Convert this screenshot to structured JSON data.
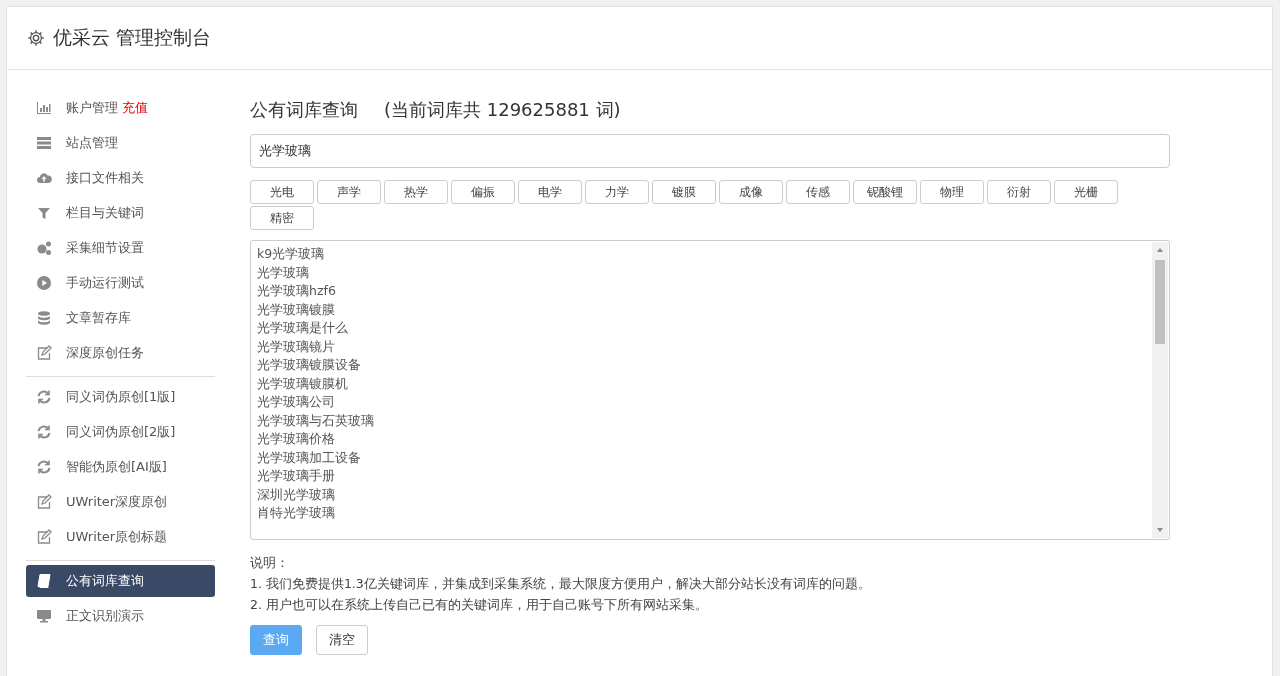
{
  "header": {
    "title": "优采云 管理控制台"
  },
  "sidebar": {
    "groups": [
      {
        "items": [
          {
            "label": "账户管理",
            "badge": "充值",
            "selected": false
          },
          {
            "label": "站点管理",
            "selected": false
          },
          {
            "label": "接口文件相关",
            "selected": false
          },
          {
            "label": "栏目与关键词",
            "selected": false
          },
          {
            "label": "采集细节设置",
            "selected": false
          },
          {
            "label": "手动运行测试",
            "selected": false
          },
          {
            "label": "文章暂存库",
            "selected": false
          },
          {
            "label": "深度原创任务",
            "selected": false
          }
        ]
      },
      {
        "items": [
          {
            "label": "同义词伪原创[1版]",
            "selected": false
          },
          {
            "label": "同义词伪原创[2版]",
            "selected": false
          },
          {
            "label": "智能伪原创[AI版]",
            "selected": false
          },
          {
            "label": "UWriter深度原创",
            "selected": false
          },
          {
            "label": "UWriter原创标题",
            "selected": false
          }
        ]
      },
      {
        "items": [
          {
            "label": "公有词库查询",
            "selected": true
          },
          {
            "label": "正文识别演示",
            "selected": false
          }
        ]
      }
    ]
  },
  "main": {
    "title": "公有词库查询",
    "count_text": "(当前词库共 129625881 词)",
    "search": {
      "value": "光学玻璃"
    },
    "tags": [
      "光电",
      "声学",
      "热学",
      "偏振",
      "电学",
      "力学",
      "镀膜",
      "成像",
      "传感",
      "铌酸锂",
      "物理",
      "衍射",
      "光栅",
      "精密"
    ],
    "results": [
      "k9光学玻璃",
      "光学玻璃",
      "光学玻璃hzf6",
      "光学玻璃镀膜",
      "光学玻璃是什么",
      "光学玻璃镜片",
      "光学玻璃镀膜设备",
      "光学玻璃镀膜机",
      "光学玻璃公司",
      "光学玻璃与石英玻璃",
      "光学玻璃价格",
      "光学玻璃加工设备",
      "光学玻璃手册",
      "深圳光学玻璃",
      "肖特光学玻璃"
    ],
    "notes_title": "说明：",
    "notes": [
      "1. 我们免费提供1.3亿关键词库，并集成到采集系统，最大限度方便用户，解决大部分站长没有词库的问题。",
      "2. 用户也可以在系统上传自己已有的关键词库，用于自己账号下所有网站采集。"
    ],
    "buttons": [
      {
        "label": "查询",
        "kind": "primary"
      },
      {
        "label": "清空",
        "kind": "default"
      }
    ]
  }
}
